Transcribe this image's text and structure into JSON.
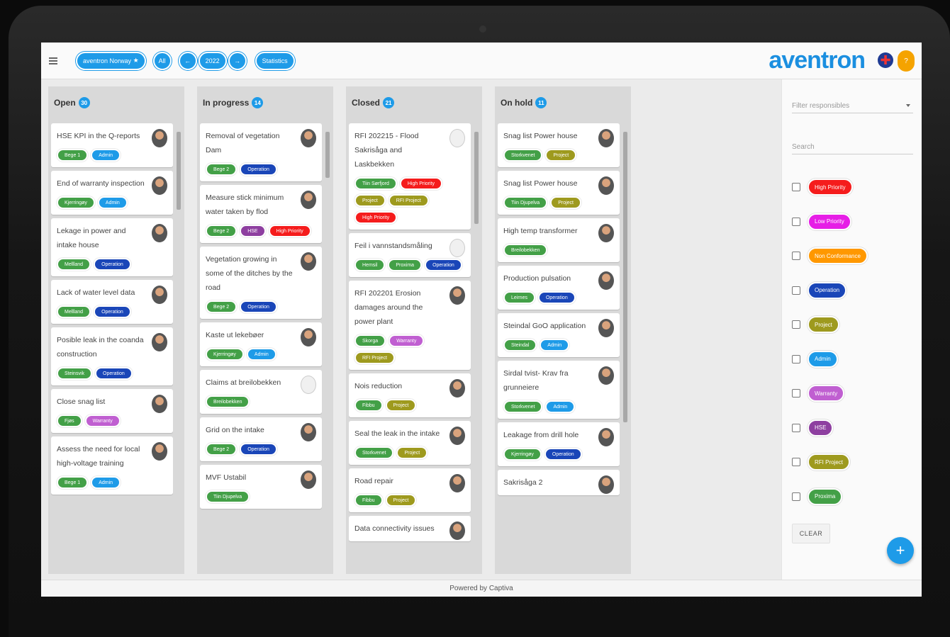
{
  "topbar": {
    "org_button": "aventron Norway",
    "all_button": "All",
    "year": "2022",
    "statistics_button": "Statistics",
    "logo": "aventron",
    "user_initial": "?"
  },
  "colors": {
    "primary": "#1e9be8",
    "green": "#43a047",
    "blue": "#1e9be8",
    "darkblue": "#1a46b8",
    "red": "#f51c1c",
    "magenta": "#e61ee6",
    "orange": "#ff9800",
    "olive": "#9e9a1e",
    "violet": "#c05fd1",
    "purple": "#8e3fa0"
  },
  "columns": [
    {
      "title": "Open",
      "count": "30",
      "cards": [
        {
          "title": "HSE KPI in the Q-reports",
          "ghost": false,
          "tags": [
            {
              "label": "Bege 1",
              "color": "green"
            },
            {
              "label": "Admin",
              "color": "blue"
            }
          ]
        },
        {
          "title": "End of warranty inspection",
          "ghost": false,
          "tags": [
            {
              "label": "Kjerringøy",
              "color": "green"
            },
            {
              "label": "Admin",
              "color": "blue"
            }
          ]
        },
        {
          "title": "Lekage in power and intake house",
          "ghost": false,
          "tags": [
            {
              "label": "Mellland",
              "color": "green"
            },
            {
              "label": "Operation",
              "color": "darkblue"
            }
          ]
        },
        {
          "title": "Lack of water level data",
          "ghost": false,
          "tags": [
            {
              "label": "Mellland",
              "color": "green"
            },
            {
              "label": "Operation",
              "color": "darkblue"
            }
          ]
        },
        {
          "title": "Posible leak in the coanda construction",
          "ghost": false,
          "tags": [
            {
              "label": "Steinsvik",
              "color": "green"
            },
            {
              "label": "Operation",
              "color": "darkblue"
            }
          ]
        },
        {
          "title": "Close snag list",
          "ghost": false,
          "tags": [
            {
              "label": "Fjøs",
              "color": "green"
            },
            {
              "label": "Warranty",
              "color": "violet"
            }
          ]
        },
        {
          "title": "Assess the need for local high-voltage training",
          "ghost": false,
          "tags": [
            {
              "label": "Bege 1",
              "color": "green"
            },
            {
              "label": "Admin",
              "color": "blue"
            }
          ]
        }
      ]
    },
    {
      "title": "In progress",
      "count": "14",
      "cards": [
        {
          "title": "Removal of vegetation Dam",
          "ghost": false,
          "tags": [
            {
              "label": "Bege 2",
              "color": "green"
            },
            {
              "label": "Operation",
              "color": "darkblue"
            }
          ]
        },
        {
          "title": "Measure stick minimum water taken by flod",
          "ghost": false,
          "tags": [
            {
              "label": "Bege 2",
              "color": "green"
            },
            {
              "label": "HSE",
              "color": "purple"
            },
            {
              "label": "High Priority",
              "color": "red"
            }
          ]
        },
        {
          "title": "Vegetation growing in some of the ditches by the road",
          "ghost": false,
          "tags": [
            {
              "label": "Bege 2",
              "color": "green"
            },
            {
              "label": "Operation",
              "color": "darkblue"
            }
          ]
        },
        {
          "title": "Kaste ut lekebøer",
          "ghost": false,
          "tags": [
            {
              "label": "Kjerringøy",
              "color": "green"
            },
            {
              "label": "Admin",
              "color": "blue"
            }
          ]
        },
        {
          "title": "Claims at breilobekken",
          "ghost": true,
          "tags": [
            {
              "label": "Breilobekken",
              "color": "green"
            }
          ]
        },
        {
          "title": "Grid on the intake",
          "ghost": false,
          "tags": [
            {
              "label": "Bege 2",
              "color": "green"
            },
            {
              "label": "Operation",
              "color": "darkblue"
            }
          ]
        },
        {
          "title": "MVF Ustabil",
          "ghost": false,
          "tags": [
            {
              "label": "Tiin Djupelva",
              "color": "green"
            }
          ]
        }
      ]
    },
    {
      "title": "Closed",
      "count": "21",
      "cards": [
        {
          "title": "RFI 202215 - Flood Sakrisåga and Laskbekken",
          "ghost": true,
          "tags": [
            {
              "label": "Tiin Sørfjord",
              "color": "green"
            },
            {
              "label": "High Priority",
              "color": "red"
            },
            {
              "label": "Project",
              "color": "olive"
            },
            {
              "label": "RFI Project",
              "color": "olive"
            },
            {
              "label": "High Priority",
              "color": "red"
            }
          ]
        },
        {
          "title": "Feil i vannstandsmåling",
          "ghost": true,
          "tags": [
            {
              "label": "Hemsil",
              "color": "green"
            },
            {
              "label": "Proxima",
              "color": "green"
            },
            {
              "label": "Operation",
              "color": "darkblue"
            }
          ]
        },
        {
          "title": "RFI 202201 Erosion damages around the power plant",
          "ghost": false,
          "tags": [
            {
              "label": "Skorga",
              "color": "green"
            },
            {
              "label": "Warranty",
              "color": "violet"
            },
            {
              "label": "RFI Project",
              "color": "olive"
            }
          ]
        },
        {
          "title": "Nois reduction",
          "ghost": false,
          "tags": [
            {
              "label": "Fibbu",
              "color": "green"
            },
            {
              "label": "Project",
              "color": "olive"
            }
          ]
        },
        {
          "title": "Seal the leak in the intake",
          "ghost": false,
          "tags": [
            {
              "label": "Storkvenet",
              "color": "green"
            },
            {
              "label": "Project",
              "color": "olive"
            }
          ]
        },
        {
          "title": "Road repair",
          "ghost": false,
          "tags": [
            {
              "label": "Fibbu",
              "color": "green"
            },
            {
              "label": "Project",
              "color": "olive"
            }
          ]
        },
        {
          "title": "Data connectivity issues",
          "ghost": false,
          "tags": []
        }
      ]
    },
    {
      "title": "On hold",
      "count": "11",
      "cards": [
        {
          "title": "Snag list Power house",
          "ghost": false,
          "tags": [
            {
              "label": "Storkvenet",
              "color": "green"
            },
            {
              "label": "Project",
              "color": "olive"
            }
          ]
        },
        {
          "title": "Snag list Power house",
          "ghost": false,
          "tags": [
            {
              "label": "Tiin Djupelva",
              "color": "green"
            },
            {
              "label": "Project",
              "color": "olive"
            }
          ]
        },
        {
          "title": "High temp transformer",
          "ghost": false,
          "tags": [
            {
              "label": "Breilobekken",
              "color": "green"
            }
          ]
        },
        {
          "title": "Production pulsation",
          "ghost": false,
          "tags": [
            {
              "label": "Leirnes",
              "color": "green"
            },
            {
              "label": "Operation",
              "color": "darkblue"
            }
          ]
        },
        {
          "title": "Steindal GoO application",
          "ghost": false,
          "tags": [
            {
              "label": "Steindal",
              "color": "green"
            },
            {
              "label": "Admin",
              "color": "blue"
            }
          ]
        },
        {
          "title": "Sirdal tvist- Krav fra grunneiere",
          "ghost": false,
          "tags": [
            {
              "label": "Storkvenet",
              "color": "green"
            },
            {
              "label": "Admin",
              "color": "blue"
            }
          ]
        },
        {
          "title": "Leakage from drill hole",
          "ghost": false,
          "tags": [
            {
              "label": "Kjerringøy",
              "color": "green"
            },
            {
              "label": "Operation",
              "color": "darkblue"
            }
          ]
        },
        {
          "title": "Sakrisåga 2",
          "ghost": false,
          "tags": []
        }
      ]
    }
  ],
  "sidebar": {
    "filter_placeholder": "Filter responsibles",
    "search_placeholder": "Search",
    "filters": [
      {
        "label": "High Priority",
        "color": "red"
      },
      {
        "label": "Low Priority",
        "color": "magenta"
      },
      {
        "label": "Non Conformance",
        "color": "orange"
      },
      {
        "label": "Operation",
        "color": "darkblue"
      },
      {
        "label": "Project",
        "color": "olive"
      },
      {
        "label": "Admin",
        "color": "blue"
      },
      {
        "label": "Warranty",
        "color": "violet"
      },
      {
        "label": "HSE",
        "color": "purple"
      },
      {
        "label": "RFI Project",
        "color": "olive"
      },
      {
        "label": "Proxima",
        "color": "green"
      }
    ],
    "clear_label": "CLEAR"
  },
  "fab_label": "+",
  "footer": "Powered by Captiva"
}
